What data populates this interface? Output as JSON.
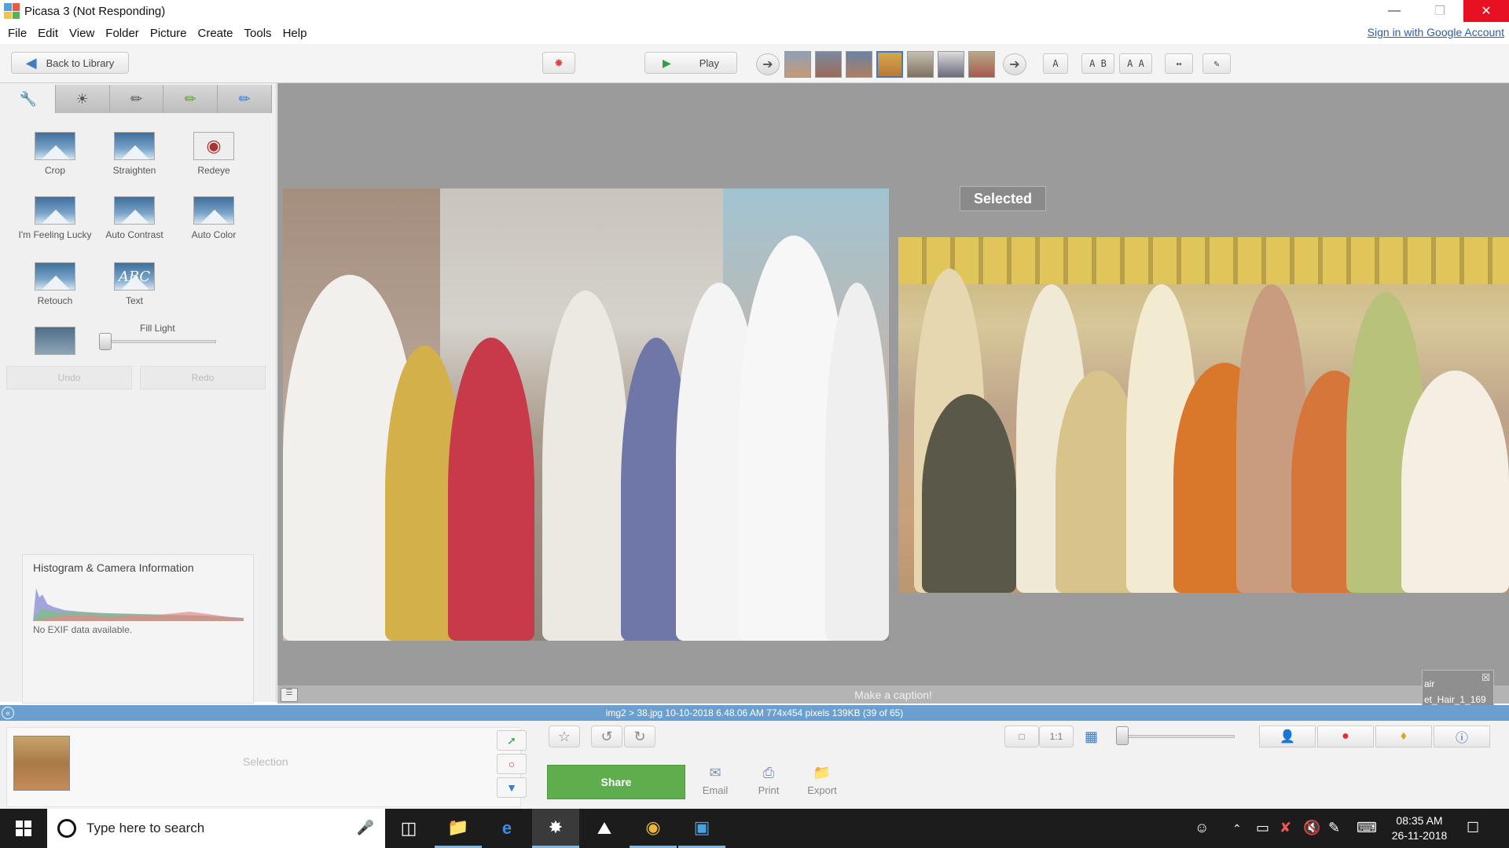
{
  "window": {
    "title": "Picasa 3 (Not Responding)"
  },
  "menu": {
    "items": [
      "File",
      "Edit",
      "View",
      "Folder",
      "Picture",
      "Create",
      "Tools",
      "Help"
    ]
  },
  "signin": {
    "label": "Sign in with Google Account"
  },
  "toolbar": {
    "back_label": "Back to Library",
    "play_label": "Play",
    "view_a": "A",
    "view_ab": "A B",
    "view_aa": "A A"
  },
  "tools": {
    "crop": "Crop",
    "straighten": "Straighten",
    "redeye": "Redeye",
    "lucky": "I'm Feeling Lucky",
    "auto_contrast": "Auto Contrast",
    "auto_color": "Auto Color",
    "retouch": "Retouch",
    "text": "Text",
    "text_icon": "ABC",
    "fill_light": "Fill Light",
    "fill_light_level": 0.0,
    "undo": "Undo",
    "redo": "Redo"
  },
  "histogram": {
    "title": "Histogram & Camera Information",
    "exif": "No EXIF data available."
  },
  "main": {
    "selected_badge": "Selected",
    "caption_placeholder": "Make a caption!",
    "popup_line1": "air",
    "popup_line2": "et_Hair_1_169"
  },
  "status": {
    "text": "img2 > 38.jpg     10-10-2018 6.48.06 AM     774x454 pixels     139KB     (39 of 65)"
  },
  "tray": {
    "selection_label": "Selection",
    "share_label": "Share",
    "email_label": "Email",
    "print_label": "Print",
    "export_label": "Export"
  },
  "taskbar": {
    "search_placeholder": "Type here to search",
    "time": "08:35 AM",
    "date": "26-11-2018"
  },
  "colors": {
    "accent_green": "#5fae4e",
    "status_blue": "#6a9fd0",
    "close_red": "#e81123"
  }
}
